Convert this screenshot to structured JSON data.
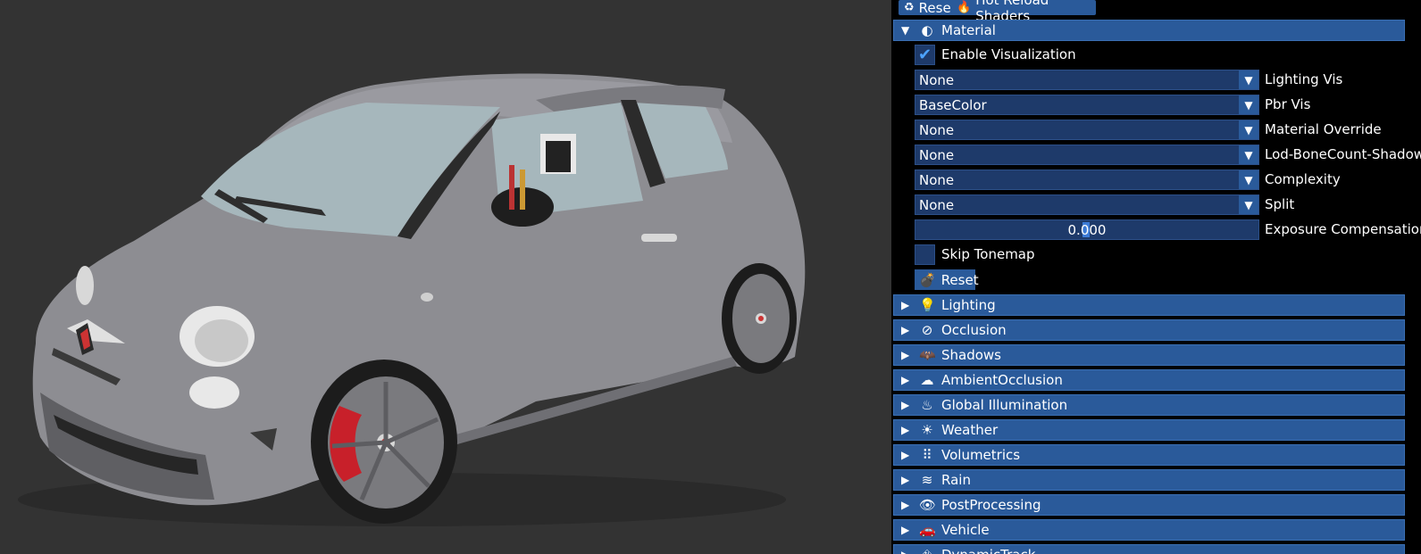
{
  "toolbar": {
    "reset_label": "Reset",
    "reset_icon": "recycle-icon",
    "hot_reload_label": "Hot Reload Shaders",
    "hot_reload_icon": "fire-icon"
  },
  "material": {
    "title": "Material",
    "icon": "palette-icon",
    "enable_visualization": {
      "label": "Enable Visualization",
      "checked": true
    },
    "lighting_vis": {
      "value": "None",
      "label": "Lighting Vis"
    },
    "pbr_vis": {
      "value": "BaseColor",
      "label": "Pbr Vis"
    },
    "material_override": {
      "value": "None",
      "label": "Material Override"
    },
    "lod_bonecount": {
      "value": "None",
      "label": "Lod-BoneCount-Shadow"
    },
    "complexity": {
      "value": "None",
      "label": "Complexity"
    },
    "split": {
      "value": "None",
      "label": "Split"
    },
    "exposure": {
      "value": "0.000",
      "label": "Exposure Compensation"
    },
    "skip_tonemap": {
      "label": "Skip Tonemap",
      "checked": false
    },
    "reset_label": "Reset"
  },
  "sections": [
    {
      "label": "Lighting",
      "icon": "lightbulb-icon"
    },
    {
      "label": "Occlusion",
      "icon": "eye-slash-icon"
    },
    {
      "label": "Shadows",
      "icon": "bat-icon"
    },
    {
      "label": "AmbientOcclusion",
      "icon": "cloud-icon"
    },
    {
      "label": "Global Illumination",
      "icon": "heat-waves-icon"
    },
    {
      "label": "Weather",
      "icon": "sun-cloud-icon"
    },
    {
      "label": "Volumetrics",
      "icon": "dots-grid-icon"
    },
    {
      "label": "Rain",
      "icon": "water-icon"
    },
    {
      "label": "PostProcessing",
      "icon": "eye-icon"
    },
    {
      "label": "Vehicle",
      "icon": "car-icon"
    },
    {
      "label": "DynamicTrack",
      "icon": "road-icon"
    }
  ],
  "colors": {
    "viewport_bg": "#333333",
    "panel_bg": "#000000",
    "header_bg": "#2a5a9a",
    "field_bg": "#1e3a6a",
    "check_color": "#4da3ff",
    "car_body": "#8d8d92",
    "brake_caliper": "#c8202a"
  }
}
